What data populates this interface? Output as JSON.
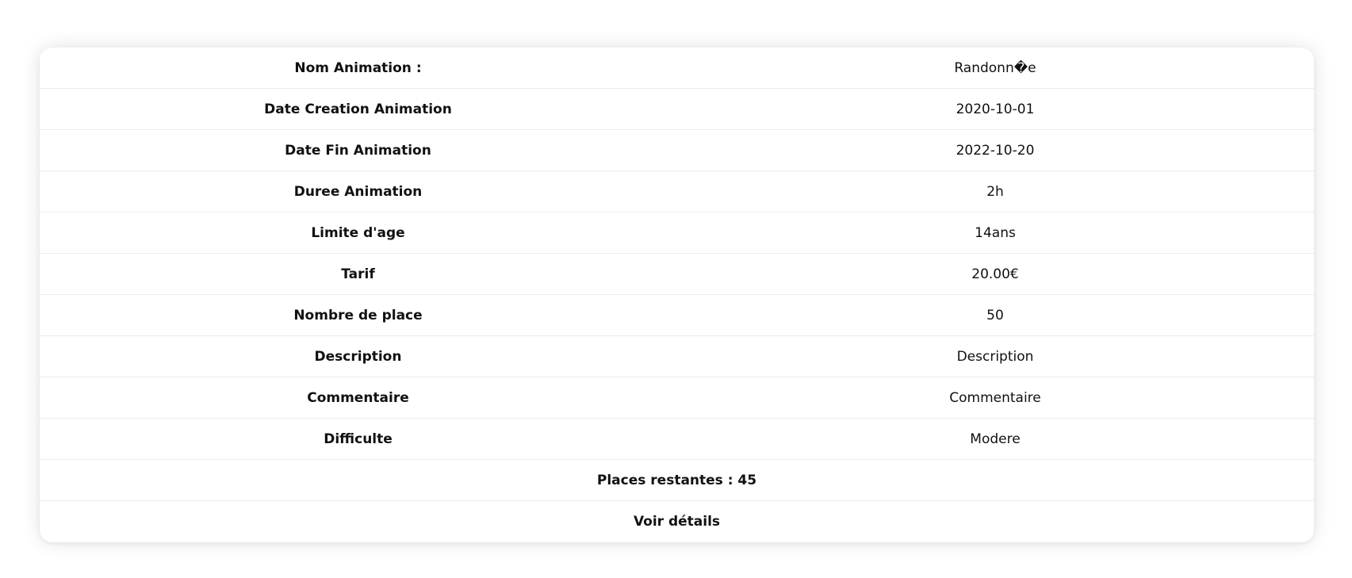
{
  "details": {
    "rows": [
      {
        "label": "Nom Animation :",
        "value": "Randonn�e"
      },
      {
        "label": "Date Creation Animation",
        "value": "2020-10-01"
      },
      {
        "label": "Date Fin Animation",
        "value": "2022-10-20"
      },
      {
        "label": "Duree Animation",
        "value": "2h"
      },
      {
        "label": "Limite d'age",
        "value": "14ans"
      },
      {
        "label": "Tarif",
        "value": "20.00€"
      },
      {
        "label": "Nombre de place",
        "value": "50"
      },
      {
        "label": "Description",
        "value": "Description"
      },
      {
        "label": "Commentaire",
        "value": "Commentaire"
      },
      {
        "label": "Difficulte",
        "value": "Modere"
      }
    ],
    "places_restantes": "Places restantes : 45",
    "voir_details": "Voir détails"
  }
}
